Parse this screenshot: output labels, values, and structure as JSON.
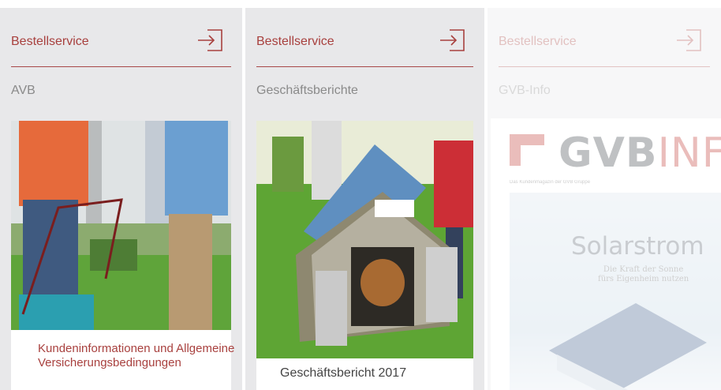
{
  "cards": [
    {
      "header_label": "Bestellservice",
      "icon": "login-arrow-icon",
      "subtitle": "AVB",
      "caption_line1": "Kundeninformationen und Allgemeine",
      "caption_line2": "Versicherungsbedingungen"
    },
    {
      "header_label": "Bestellservice",
      "icon": "login-arrow-icon",
      "subtitle": "Geschäftsberichte",
      "caption_line1": "Geschäftsbericht 2017"
    },
    {
      "header_label": "Bestellservice",
      "icon": "login-arrow-icon",
      "subtitle": "GVB-Info",
      "magazine": {
        "logo_main": "GVB",
        "logo_accent": "INF",
        "strip": "Das Kundenmagazin der GVB Gruppe",
        "cover_title": "Solarstrom",
        "cover_tag_line1": "Die Kraft der Sonne",
        "cover_tag_line2": "fürs Eigenheim nutzen"
      }
    }
  ],
  "colors": {
    "accent": "#a8403e",
    "card_bg": "#e8e8ea",
    "brand_red": "#c0352f"
  }
}
